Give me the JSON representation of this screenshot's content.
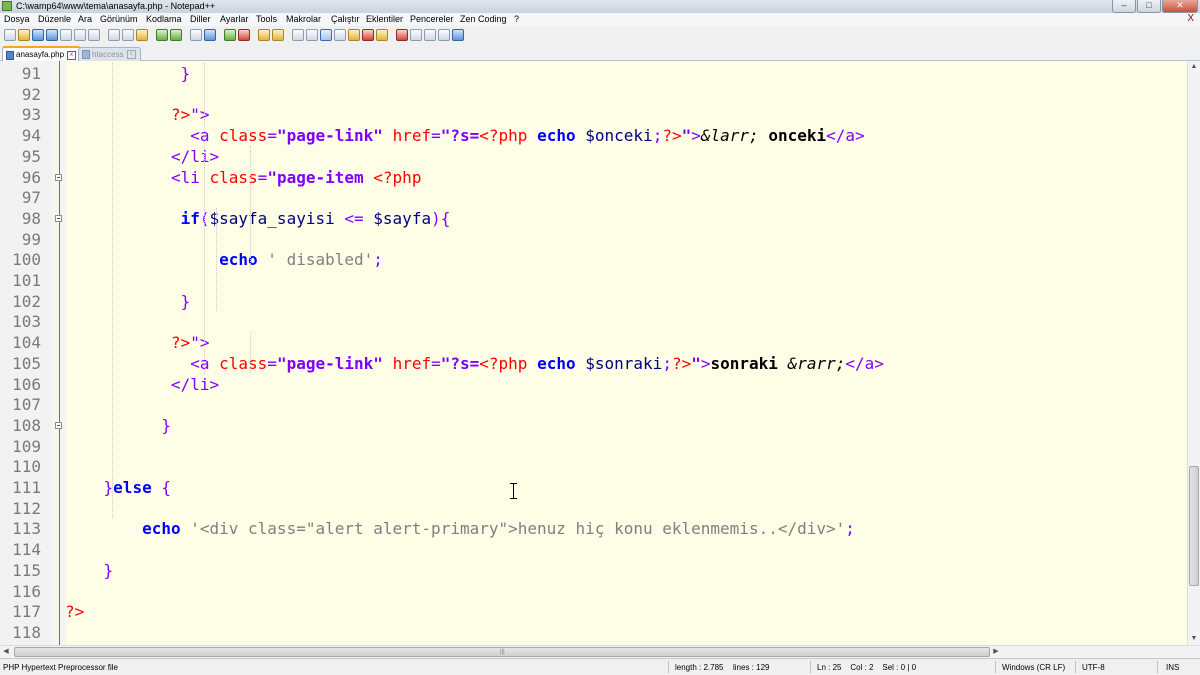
{
  "window": {
    "title": "C:\\wamp64\\www\\tema\\anasayfa.php - Notepad++",
    "controls": {
      "minimize": "–",
      "maximize": "□",
      "close": "✕"
    }
  },
  "menu": {
    "items": [
      "Dosya",
      "Düzenle",
      "Ara",
      "Görünüm",
      "Kodlama",
      "Diller",
      "Ayarlar",
      "Tools",
      "Makrolar",
      "Çalıştır",
      "Eklentiler",
      "Pencereler",
      "Zen Coding",
      "?"
    ],
    "close": "X"
  },
  "toolbar": {
    "icons": [
      "new-file-icon",
      "open-file-icon",
      "save-icon",
      "save-all-icon",
      "close-icon",
      "close-all-icon",
      "print-icon",
      "cut-icon",
      "copy-icon",
      "paste-icon",
      "undo-icon",
      "redo-icon",
      "find-icon",
      "replace-icon",
      "zoom-in-icon",
      "zoom-out-icon",
      "sync-vertical-icon",
      "sync-horizontal-icon",
      "word-wrap-icon",
      "show-all-chars-icon",
      "indent-guide-icon",
      "language-icon",
      "function-list-icon",
      "doc-map-icon",
      "monitor-icon",
      "record-macro-icon",
      "stop-record-icon",
      "play-macro-icon",
      "run-macro-multiple-icon",
      "save-macro-icon"
    ]
  },
  "tabs": [
    {
      "label": "anasayfa.php",
      "active": true
    },
    {
      "label": "htaccess",
      "active": false
    }
  ],
  "editor": {
    "lines": [
      {
        "n": "91",
        "tokens": [
          [
            "pl",
            "            "
          ],
          [
            "tag",
            "}"
          ]
        ]
      },
      {
        "n": "92",
        "tokens": []
      },
      {
        "n": "93",
        "tokens": [
          [
            "pl",
            "           "
          ],
          [
            "php",
            "?>"
          ],
          [
            "tag",
            "\">"
          ]
        ]
      },
      {
        "n": "94",
        "tokens": [
          [
            "pl",
            "             "
          ],
          [
            "tag",
            "<a "
          ],
          [
            "attr",
            "class"
          ],
          [
            "tag",
            "="
          ],
          [
            "val",
            "\"page-link\""
          ],
          [
            "tag",
            " "
          ],
          [
            "attr",
            "href"
          ],
          [
            "tag",
            "="
          ],
          [
            "val",
            "\"?s="
          ],
          [
            "php",
            "<?php"
          ],
          [
            "pl",
            " "
          ],
          [
            "kw",
            "echo"
          ],
          [
            "pl",
            " "
          ],
          [
            "var",
            "$onceki"
          ],
          [
            "op",
            ";"
          ],
          [
            "php",
            "?>"
          ],
          [
            "val",
            "\""
          ],
          [
            "tag",
            ">"
          ],
          [
            "ent",
            "&larr;"
          ],
          [
            "pl",
            " "
          ],
          [
            "b",
            "onceki"
          ],
          [
            "tag",
            "</a>"
          ]
        ]
      },
      {
        "n": "95",
        "tokens": [
          [
            "pl",
            "           "
          ],
          [
            "tag",
            "</li>"
          ]
        ]
      },
      {
        "n": "96",
        "tokens": [
          [
            "pl",
            "           "
          ],
          [
            "tag",
            "<li "
          ],
          [
            "attr",
            "class"
          ],
          [
            "tag",
            "="
          ],
          [
            "val",
            "\"page-item"
          ],
          [
            "pl",
            " "
          ],
          [
            "php",
            "<?php"
          ]
        ]
      },
      {
        "n": "97",
        "tokens": []
      },
      {
        "n": "98",
        "tokens": [
          [
            "pl",
            "            "
          ],
          [
            "kw",
            "if"
          ],
          [
            "op",
            "("
          ],
          [
            "var",
            "$sayfa_sayisi"
          ],
          [
            "pl",
            " "
          ],
          [
            "op",
            "<="
          ],
          [
            "pl",
            " "
          ],
          [
            "var",
            "$sayfa"
          ],
          [
            "op",
            "){"
          ]
        ]
      },
      {
        "n": "99",
        "tokens": []
      },
      {
        "n": "100",
        "tokens": [
          [
            "pl",
            "                "
          ],
          [
            "kw",
            "echo"
          ],
          [
            "pl",
            " "
          ],
          [
            "str",
            "' disabled'"
          ],
          [
            "op",
            ";"
          ]
        ]
      },
      {
        "n": "101",
        "tokens": []
      },
      {
        "n": "102",
        "tokens": [
          [
            "pl",
            "            "
          ],
          [
            "op",
            "}"
          ]
        ]
      },
      {
        "n": "103",
        "tokens": []
      },
      {
        "n": "104",
        "tokens": [
          [
            "pl",
            "           "
          ],
          [
            "php",
            "?>"
          ],
          [
            "tag",
            "\">"
          ]
        ]
      },
      {
        "n": "105",
        "tokens": [
          [
            "pl",
            "             "
          ],
          [
            "tag",
            "<a "
          ],
          [
            "attr",
            "class"
          ],
          [
            "tag",
            "="
          ],
          [
            "val",
            "\"page-link\""
          ],
          [
            "tag",
            " "
          ],
          [
            "attr",
            "href"
          ],
          [
            "tag",
            "="
          ],
          [
            "val",
            "\"?s="
          ],
          [
            "php",
            "<?php"
          ],
          [
            "pl",
            " "
          ],
          [
            "kw",
            "echo"
          ],
          [
            "pl",
            " "
          ],
          [
            "var",
            "$sonraki"
          ],
          [
            "op",
            ";"
          ],
          [
            "php",
            "?>"
          ],
          [
            "val",
            "\""
          ],
          [
            "tag",
            ">"
          ],
          [
            "b",
            "sonraki"
          ],
          [
            "pl",
            " "
          ],
          [
            "ent",
            "&rarr;"
          ],
          [
            "tag",
            "</a>"
          ]
        ]
      },
      {
        "n": "106",
        "tokens": [
          [
            "pl",
            "           "
          ],
          [
            "tag",
            "</li>"
          ]
        ]
      },
      {
        "n": "107",
        "tokens": []
      },
      {
        "n": "108",
        "tokens": [
          [
            "pl",
            "          "
          ],
          [
            "op",
            "}"
          ]
        ]
      },
      {
        "n": "109",
        "tokens": []
      },
      {
        "n": "110",
        "tokens": []
      },
      {
        "n": "111",
        "tokens": [
          [
            "pl",
            "    "
          ],
          [
            "op",
            "}"
          ],
          [
            "kw",
            "else"
          ],
          [
            "pl",
            " "
          ],
          [
            "op",
            "{"
          ]
        ]
      },
      {
        "n": "112",
        "tokens": []
      },
      {
        "n": "113",
        "tokens": [
          [
            "pl",
            "        "
          ],
          [
            "kw",
            "echo"
          ],
          [
            "pl",
            " "
          ],
          [
            "str",
            "'<div class=\"alert alert-primary\">henuz hiç konu eklenmemis..</div>'"
          ],
          [
            "op",
            ";"
          ]
        ]
      },
      {
        "n": "114",
        "tokens": []
      },
      {
        "n": "115",
        "tokens": [
          [
            "pl",
            "    "
          ],
          [
            "op",
            "}"
          ]
        ]
      },
      {
        "n": "116",
        "tokens": []
      },
      {
        "n": "117",
        "tokens": [
          [
            "php",
            "?>"
          ]
        ]
      },
      {
        "n": "118",
        "tokens": []
      }
    ]
  },
  "statusbar": {
    "filetype": "PHP Hypertext Preprocessor file",
    "length": "length : 2.785",
    "lines": "lines : 129",
    "position": "Ln : 25    Col : 2    Sel : 0 | 0",
    "eol": "Windows (CR LF)",
    "encoding": "UTF-8",
    "mode": "INS"
  },
  "colors": {
    "tag": "#8000ff",
    "attr": "#ff0000",
    "keyword": "#0000ff",
    "variable": "#000080",
    "string": "#808080",
    "editor_bg": "#fefde6"
  }
}
